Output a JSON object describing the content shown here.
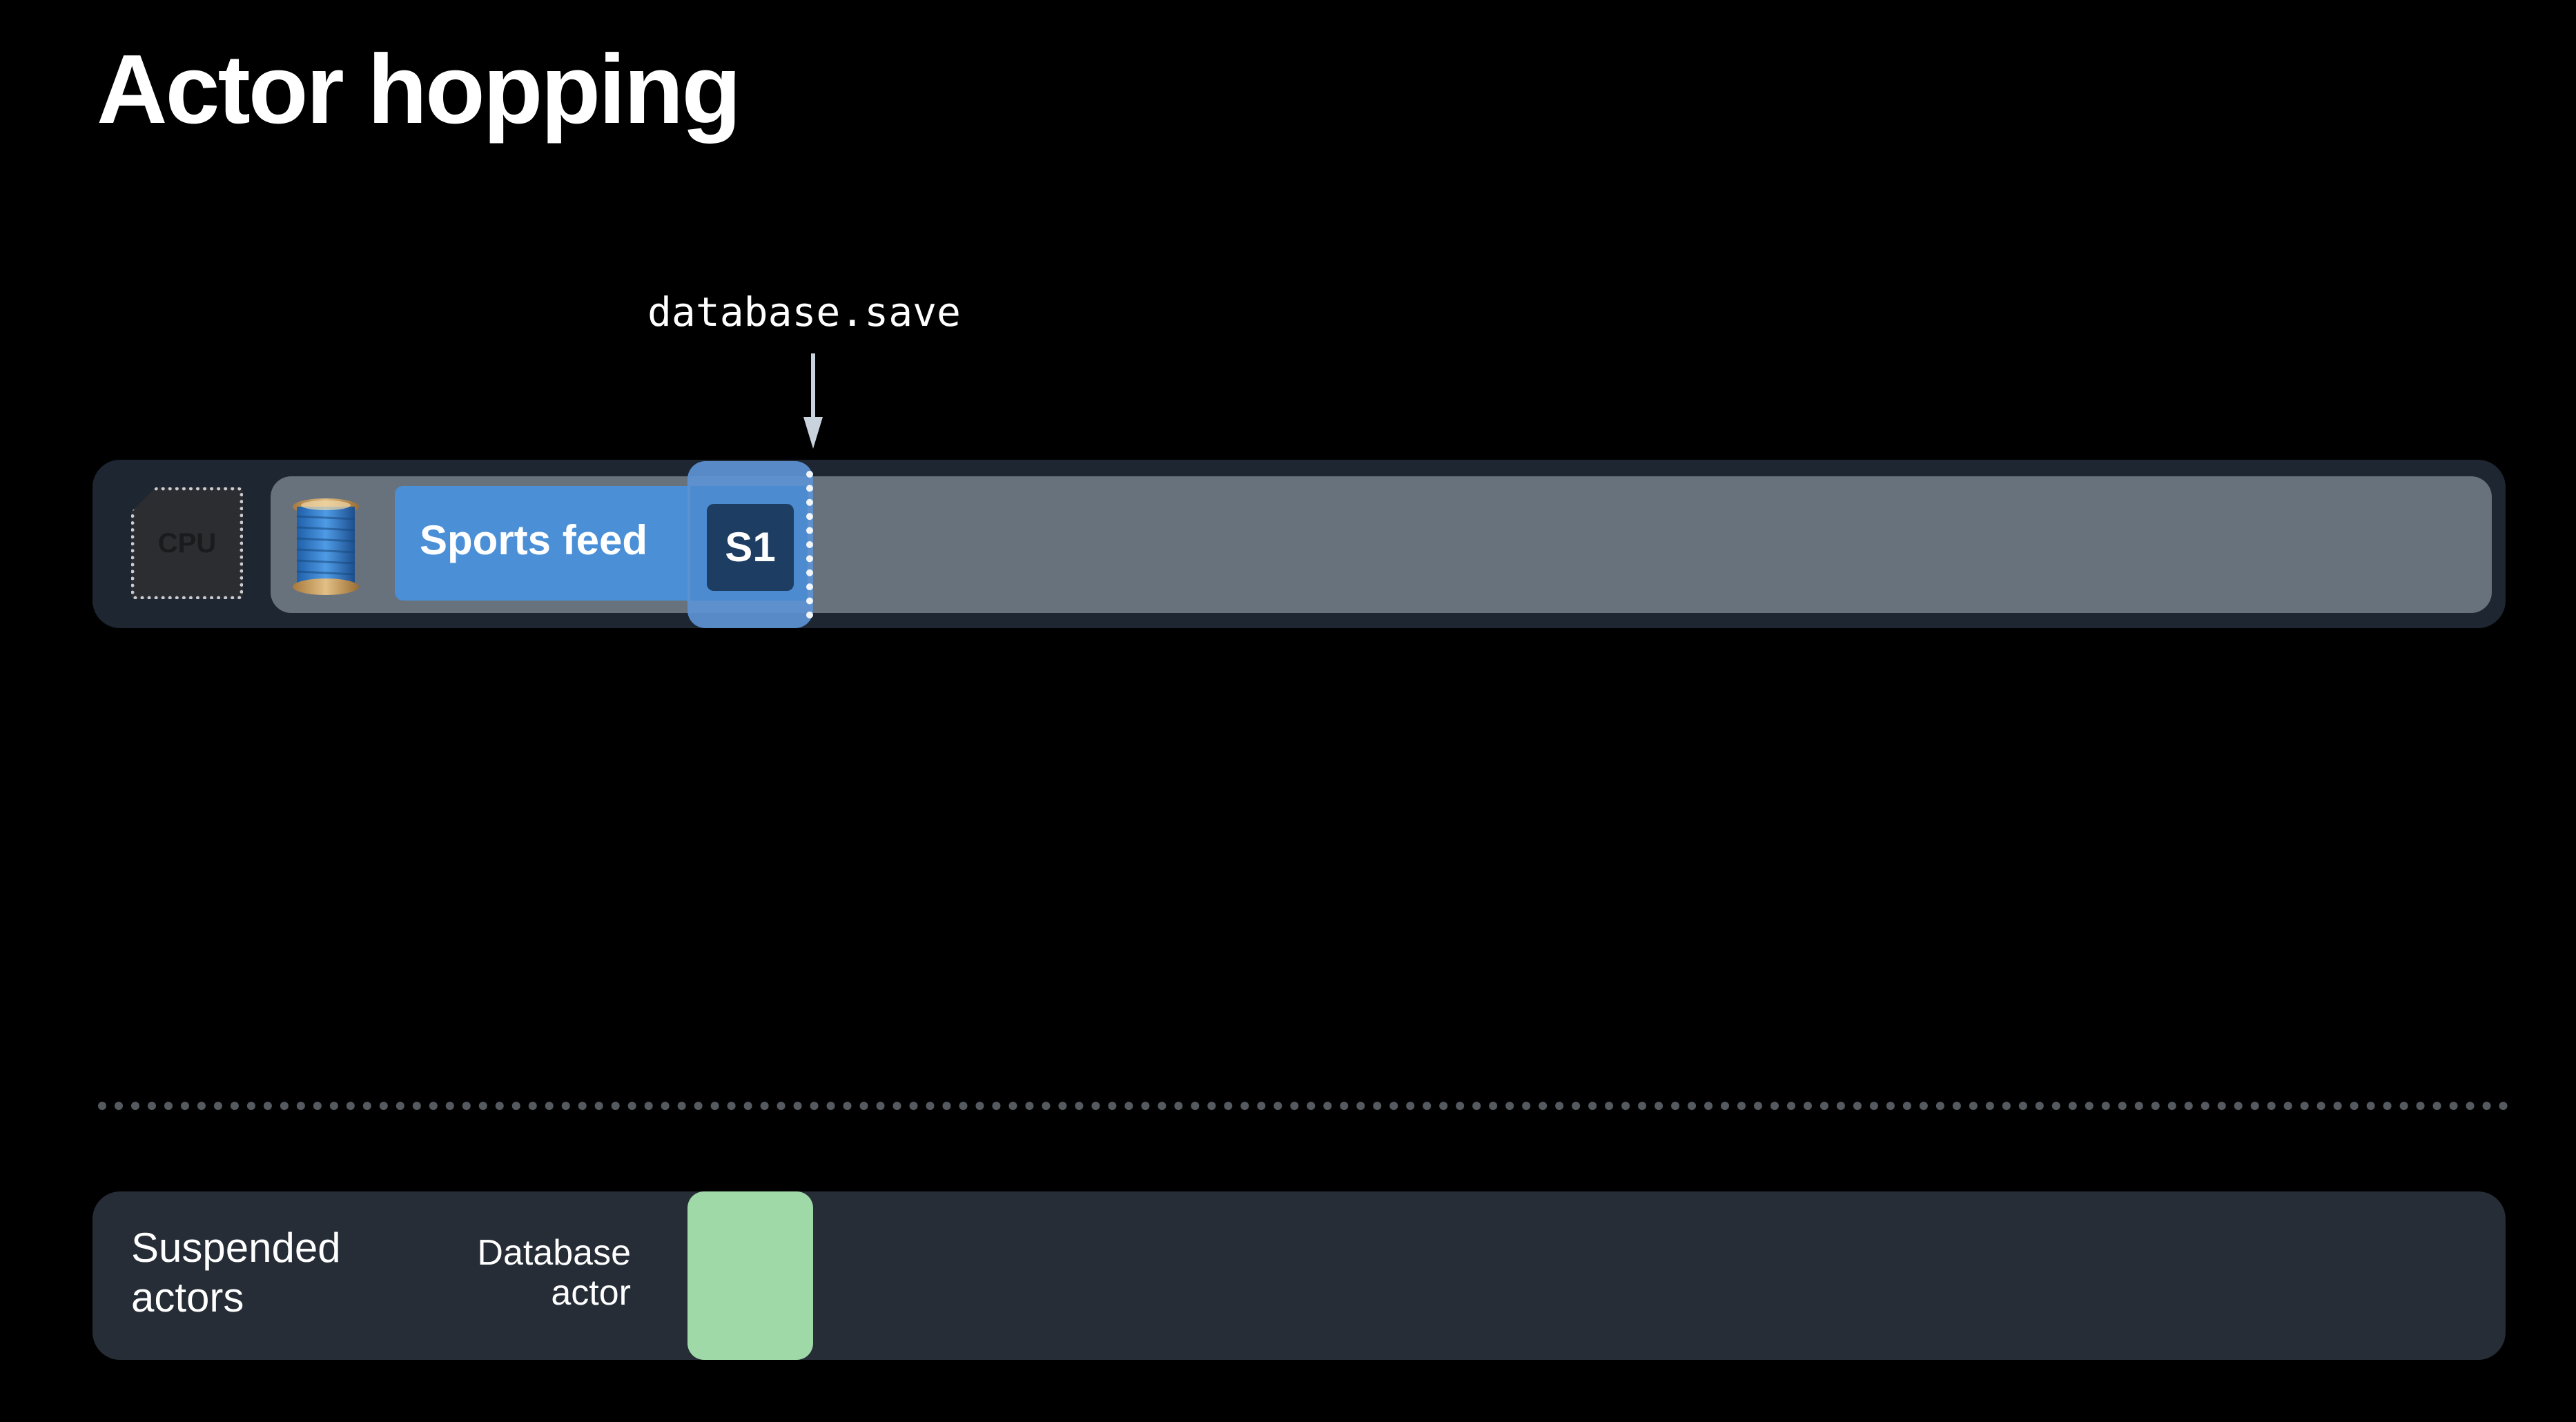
{
  "title": "Actor hopping",
  "call_label": "database.save",
  "cpu": {
    "label": "CPU",
    "icon": "cpu-chip-icon"
  },
  "thread": {
    "icon": "spool-of-thread-icon",
    "task_label": "Sports feed",
    "suspension_point_label": "S1"
  },
  "suspended": {
    "heading_line1": "Suspended",
    "heading_line2": "actors",
    "actor_line1": "Database",
    "actor_line2": "actor"
  },
  "colors": {
    "background": "#000000",
    "track": "#1e2631",
    "thread_lane": "#68727c",
    "task": "#4b8fd7",
    "highlight": "#5c93d2",
    "suspension_chip": "#1d3d62",
    "suspended_panel": "#262d36",
    "database_actor": "#9fd9a8"
  }
}
